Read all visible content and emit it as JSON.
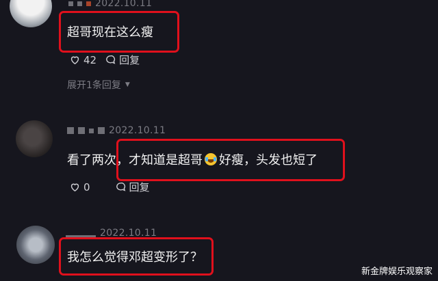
{
  "comments": [
    {
      "date": "2022.10.11",
      "text": "超哥现在这么瘦",
      "likes": "42",
      "reply_label": "回复",
      "expand_label": "展开1条回复"
    },
    {
      "date": "2022.10.11",
      "text_before": "看了两次，",
      "text_highlight_1": "才知道是超哥",
      "emoji_name": "rofl-emoji-icon",
      "text_highlight_2": "好瘦，头发也短了",
      "likes": "0",
      "reply_label": "回复"
    },
    {
      "date": "2022.10.11",
      "text": "我怎么觉得邓超变形了？"
    }
  ],
  "watermark": "新金牌娱乐观察家",
  "colors": {
    "highlight_border": "#e0101c",
    "background": "#16161e"
  }
}
